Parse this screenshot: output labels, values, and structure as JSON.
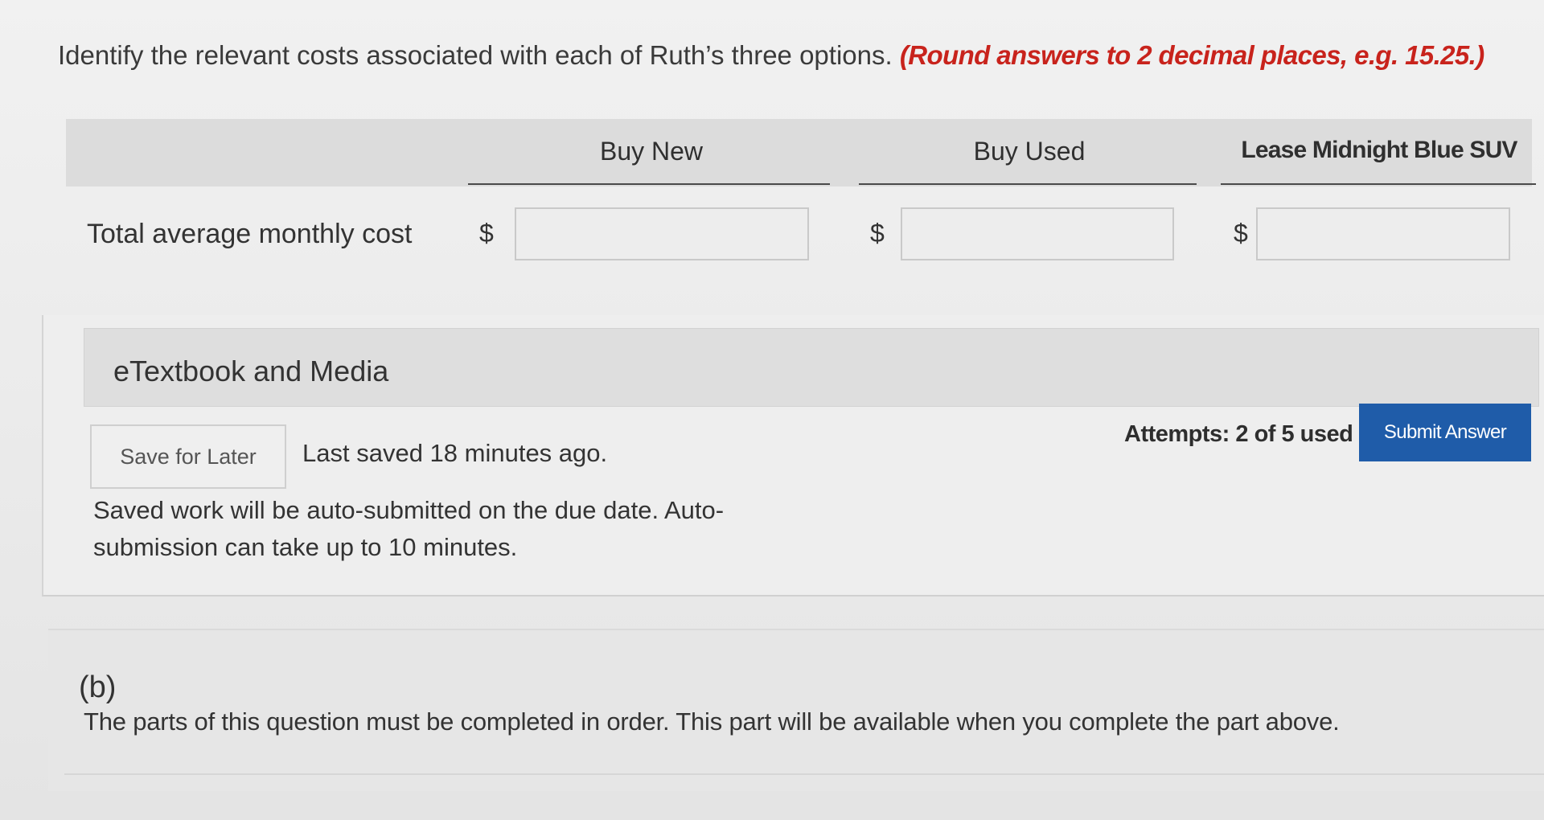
{
  "question": {
    "text": "Identify the relevant costs associated with each of Ruth’s three options.",
    "hint": "(Round answers to 2 decimal places, e.g. 15.25.)"
  },
  "table": {
    "columns": [
      {
        "label": "Buy New"
      },
      {
        "label": "Buy Used"
      },
      {
        "label": "Lease Midnight Blue SUV"
      }
    ],
    "row_label": "Total average monthly cost",
    "currency_symbol": "$",
    "values": [
      "",
      "",
      ""
    ]
  },
  "media": {
    "title": "eTextbook and Media"
  },
  "actions": {
    "save_label": "Save for Later",
    "last_saved": "Last saved 18 minutes ago.",
    "attempts": "Attempts: 2 of 5 used",
    "submit_label": "Submit Answer",
    "autosubmit_note": "Saved work will be auto-submitted on the due date. Auto-submission can take up to 10 minutes."
  },
  "part_b": {
    "label": "(b)",
    "text": "The parts of this question must be completed in order. This part will be available when you complete the part above."
  },
  "colors": {
    "hint_red": "#c8231c",
    "submit_blue": "#1f5ca9"
  }
}
